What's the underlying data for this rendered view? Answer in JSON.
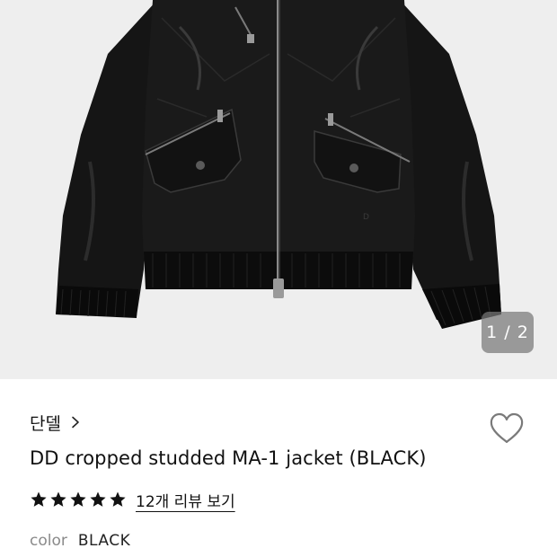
{
  "gallery": {
    "image_subject": "black cropped MA-1 bomber jacket",
    "counter": "1 / 2",
    "current_index": 1,
    "total_images": 2
  },
  "product": {
    "brand": "단델",
    "title": "DD cropped studded MA-1 jacket (BLACK)",
    "rating": 5,
    "rating_max": 5,
    "review_link": "12개 리뷰 보기",
    "color_label": "color",
    "color_value": "BLACK"
  },
  "icons": {
    "brand_chevron": "chevron-right-icon",
    "wishlist": "heart-outline-icon",
    "star": "star-filled-icon"
  },
  "colors": {
    "background": "#ffffff",
    "gallery_bg": "#eeeeee",
    "text_primary": "#111111",
    "text_muted": "#8a8a8a",
    "counter_bg": "#787878"
  }
}
